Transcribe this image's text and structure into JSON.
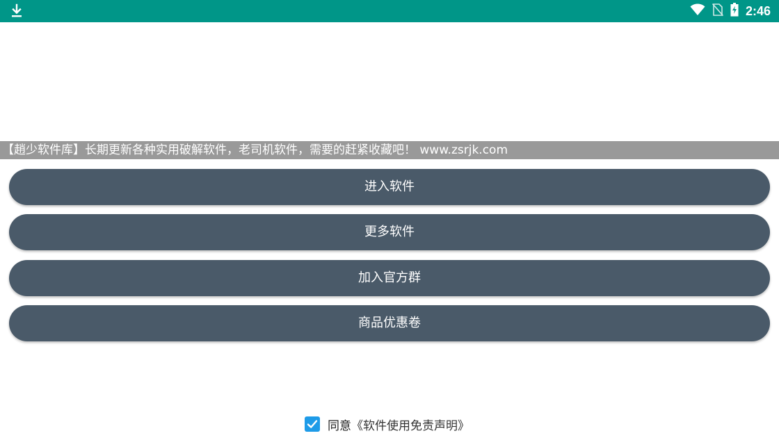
{
  "status_bar": {
    "time": "2:46",
    "icons": [
      "download-icon",
      "wifi-icon",
      "no-sim-icon",
      "battery-charging-icon"
    ],
    "background": "#009688"
  },
  "marquee": {
    "text": "【趙少软件库】长期更新各种实用破解软件，老司机软件，需要的赶紧收藏吧！ www.zsrjk.com"
  },
  "menu": {
    "enter_software": "进入软件",
    "more_software": "更多软件",
    "join_group": "加入官方群",
    "coupons": "商品优惠卷",
    "button_color": "#4a5a69"
  },
  "agreement": {
    "checked": true,
    "agree_label": "同意",
    "disclaimer_link": "《软件使用免责声明》",
    "checkbox_color": "#1e9be8"
  }
}
